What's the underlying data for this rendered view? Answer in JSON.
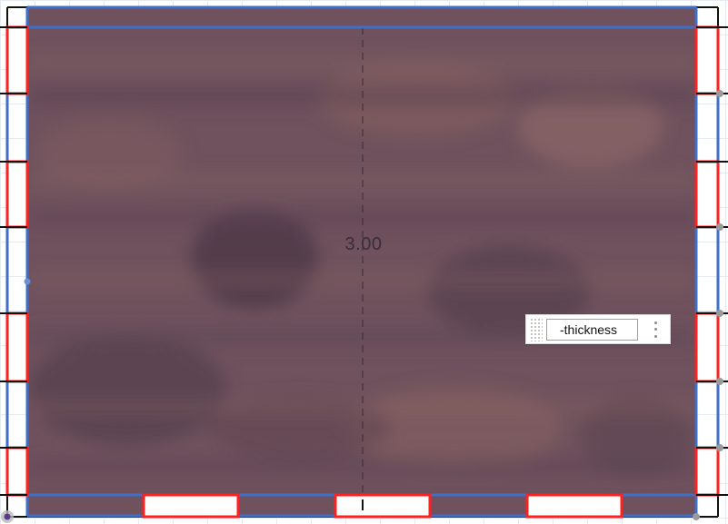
{
  "model": {
    "dimension_label": "3.00",
    "colors": {
      "panel_wood": "#6e4f5a",
      "edge_blue": "#3f6fc7",
      "joint_red": "#ff2020",
      "outline_black": "#111111",
      "grid": "#e6ebf2"
    }
  },
  "parameter_input": {
    "value": "-thickness",
    "menu_icon": "kebab-menu-icon",
    "grip_icon": "drag-grip-icon"
  }
}
